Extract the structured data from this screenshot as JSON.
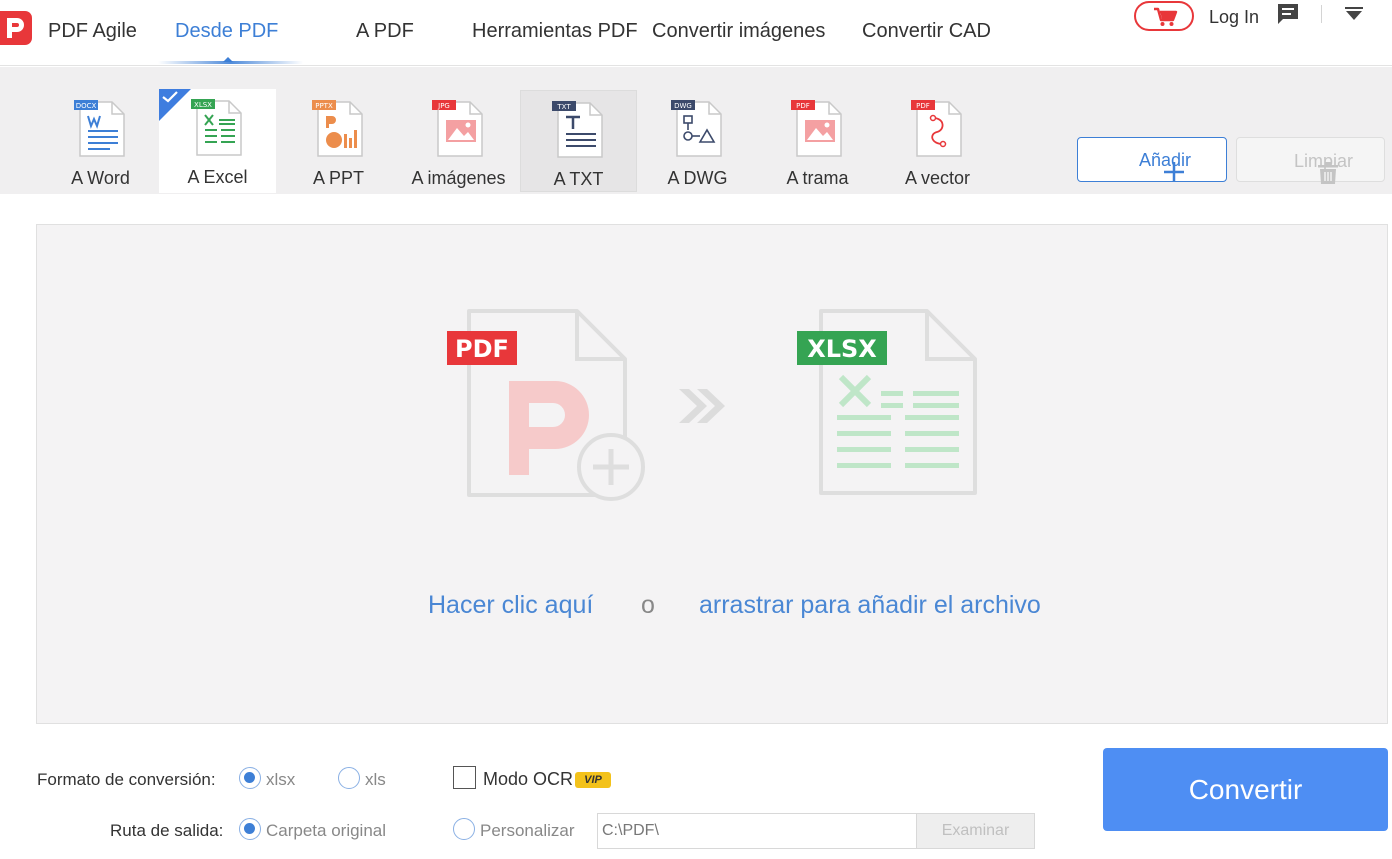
{
  "app": {
    "name": "PDF Agile"
  },
  "menu": {
    "items": [
      {
        "label": "Desde PDF"
      },
      {
        "label": "A PDF"
      },
      {
        "label": "Herramientas PDF"
      },
      {
        "label": "Convertir imágenes"
      },
      {
        "label": "Convertir CAD"
      }
    ],
    "active": "Desde PDF",
    "login_label": "Log In"
  },
  "toolbar": {
    "tools": [
      {
        "label": "A Word",
        "badge": "DOCX",
        "color": "#3d7fd6",
        "icon": "word-doc-icon"
      },
      {
        "label": "A Excel",
        "badge": "XLSX",
        "color": "#35a453",
        "icon": "excel-doc-icon"
      },
      {
        "label": "A PPT",
        "badge": "PPTX",
        "color": "#ec8d4c",
        "icon": "ppt-doc-icon"
      },
      {
        "label": "A imágenes",
        "badge": "JPG",
        "color": "#e8373a",
        "icon": "image-doc-icon"
      },
      {
        "label": "A TXT",
        "badge": "TXT",
        "color": "#3c4a6b",
        "icon": "txt-doc-icon"
      },
      {
        "label": "A DWG",
        "badge": "DWG",
        "color": "#3c4a6b",
        "icon": "dwg-doc-icon"
      },
      {
        "label": "A trama",
        "badge": "PDF",
        "color": "#e8373a",
        "icon": "raster-doc-icon"
      },
      {
        "label": "A vector",
        "badge": "PDF",
        "color": "#e8373a",
        "icon": "vector-doc-icon"
      }
    ],
    "selected": "A Excel",
    "add_label": "Añadir",
    "clear_label": "Limpiar"
  },
  "dropzone": {
    "source_badge": "PDF",
    "target_badge": "XLSX",
    "click_text": "Hacer clic aquí",
    "or_text": "o",
    "drag_text": "arrastrar para añadir el archivo"
  },
  "options": {
    "format_label": "Formato de conversión:",
    "formats": [
      {
        "label": "xlsx",
        "checked": true
      },
      {
        "label": "xls",
        "checked": false
      }
    ],
    "ocr_label": "Modo OCR",
    "ocr_checked": false,
    "vip_badge": "VIP",
    "output_label": "Ruta de salida:",
    "outputs": [
      {
        "label": "Carpeta original",
        "checked": true
      },
      {
        "label": "Personalizar",
        "checked": false
      }
    ],
    "path_value": "C:\\PDF\\",
    "browse_label": "Examinar",
    "convert_label": "Convertir"
  },
  "colors": {
    "accent": "#3d7fd6",
    "brand": "#e8373a",
    "convert": "#4e8ef3",
    "excel": "#35a453"
  }
}
